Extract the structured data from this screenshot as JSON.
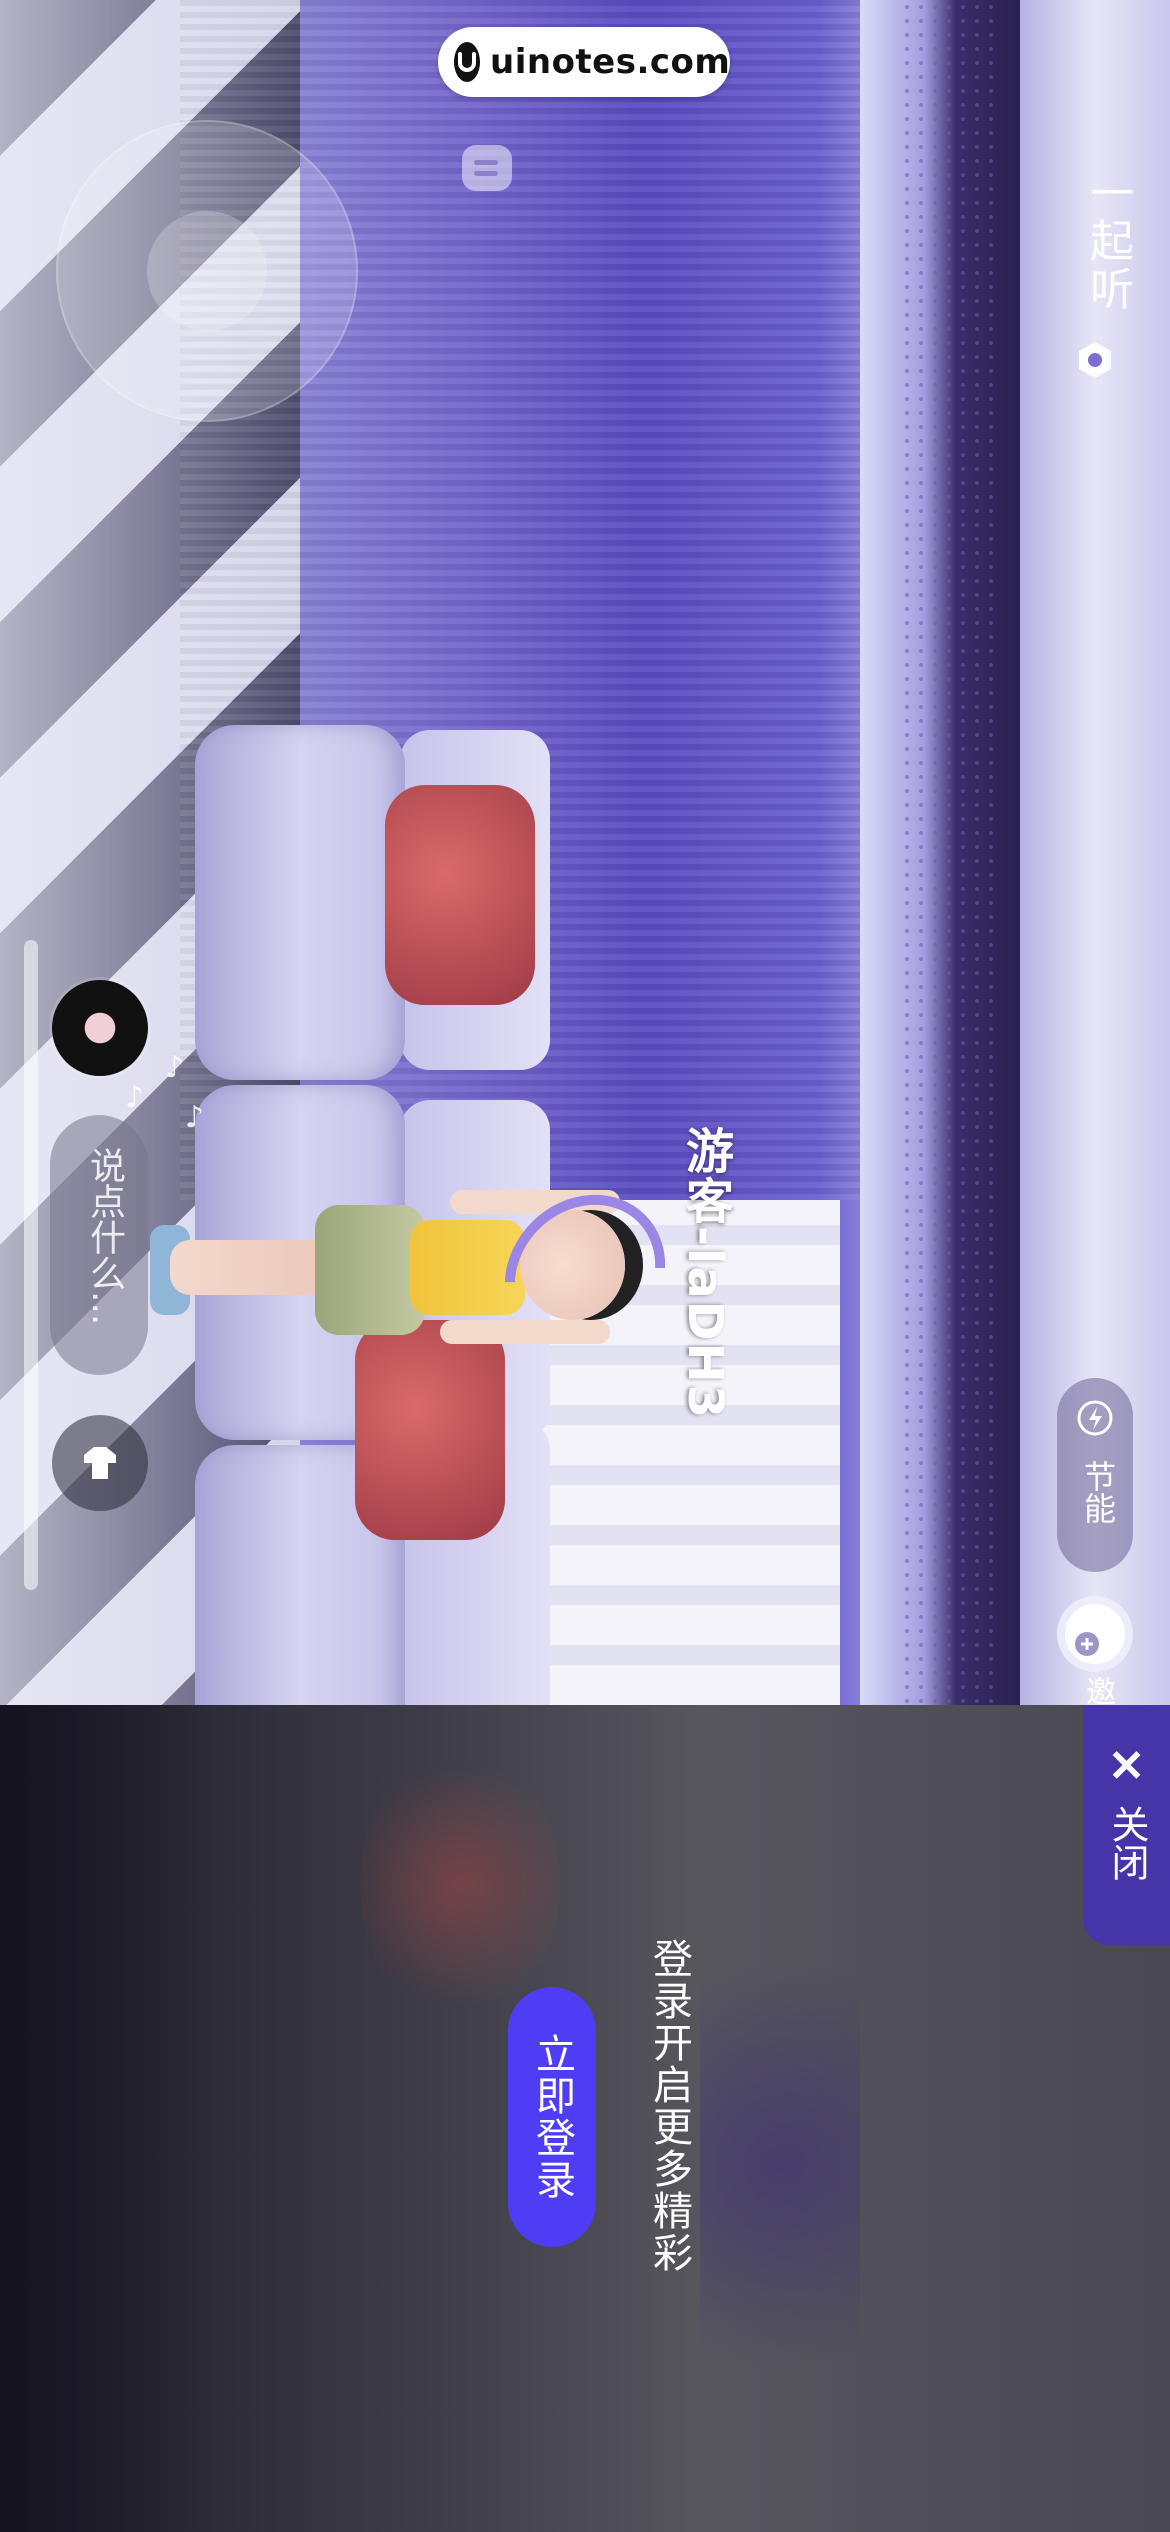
{
  "watermark": {
    "text": "uinotes.com"
  },
  "room": {
    "title": "一起听"
  },
  "player": {
    "name": "游客-laDH3"
  },
  "chat": {
    "placeholder": "说点什么..."
  },
  "power": {
    "label": "节能"
  },
  "invite": {
    "label": "邀"
  },
  "login": {
    "prompt": "登录开启更多精彩",
    "button_label": "立即登录"
  },
  "close": {
    "label": "关闭"
  },
  "colors": {
    "login_button": "#4f3df5",
    "close_tab": "#4535a8"
  }
}
